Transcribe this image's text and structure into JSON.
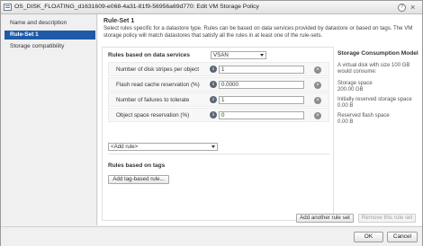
{
  "window": {
    "title": "OS_DISK_FLOATING_d1631609-e068-4a31-81f9-56956a69d770: Edit VM Storage Policy",
    "help_label": "?",
    "close_label": "×"
  },
  "sidebar": {
    "items": [
      {
        "label": "Name and description",
        "active": false
      },
      {
        "label": "Rule-Set 1",
        "active": true
      },
      {
        "label": "Storage compatibility",
        "active": false
      }
    ]
  },
  "main": {
    "heading": "Rule-Set 1",
    "description": "Select rules specific for a datastore type. Rules can be based on data services provided by datastore or based on tags. The VM storage policy will match datastores that satisfy all the rules in at least one of the rule-sets.",
    "data_services_label": "Rules based on data services",
    "data_services_value": "VSAN",
    "rules": [
      {
        "label": "Number of disk stripes per object",
        "value": "1"
      },
      {
        "label": "Flash read cache reservation (%)",
        "value": "0.0000"
      },
      {
        "label": "Number of failures to tolerate",
        "value": "1"
      },
      {
        "label": "Object space reservation (%)",
        "value": "0"
      }
    ],
    "add_rule_label": "<Add rule>",
    "tags_label": "Rules based on tags",
    "add_tag_button": "Add tag-based rule...",
    "add_ruleset_button": "Add another rule set",
    "remove_ruleset_button": "Remove this rule set"
  },
  "consumption": {
    "title": "Storage Consumption Model",
    "intro": "A virtual disk with size 100 GB would consume:",
    "storage_space_label": "Storage space",
    "storage_space_value": "200.00 GB",
    "initially_reserved_label": "Initially reserved storage space",
    "initially_reserved_value": "0.00 B",
    "reserved_flash_label": "Reserved flash space",
    "reserved_flash_value": "0.00 B"
  },
  "footer": {
    "ok_label": "OK",
    "cancel_label": "Cancel"
  }
}
